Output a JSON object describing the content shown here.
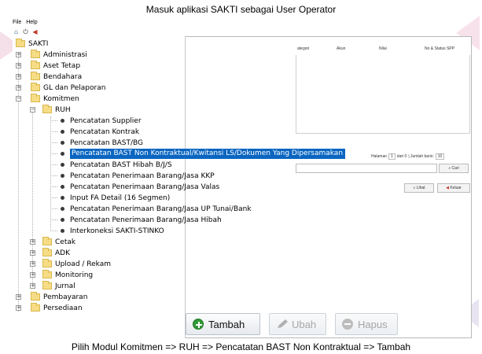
{
  "caption_top": "Masuk aplikasi SAKTI sebagai User Operator",
  "caption_bottom": "Pilih Modul Komitmen => RUH => Pencatatan BAST Non Kontraktual => Tambah",
  "menu": {
    "file": "File",
    "help": "Help"
  },
  "toolbar_icons": [
    "home-icon",
    "power-icon",
    "logout-icon"
  ],
  "tree": {
    "root": "SAKTI",
    "nodes": {
      "administrasi": "Administrasi",
      "aset_tetap": "Aset Tetap",
      "bendahara": "Bendahara",
      "gl": "GL dan Pelaporan",
      "komitmen": "Komitmen",
      "ruh": "RUH",
      "ruh_items": [
        "Pencatatan Supplier",
        "Pencatatan Kontrak",
        "Pencatatan BAST/BG",
        "Pencatatan BAST Non Kontraktual/Kwitansi LS/Dokumen Yang Dipersamakan",
        "Pencatatan BAST Hibah B/J/S",
        "Pencatatan Penerimaan Barang/Jasa KKP",
        "Pencatatan Penerimaan Barang/Jasa Valas",
        "Input FA Detail (16 Segmen)",
        "Pencatatan Penerimaan Barang/Jasa UP Tunai/Bank",
        "Pencatatan Penerimaan Barang/Jasa Hibah",
        "Interkoneksi SAKTI-STINKO"
      ],
      "cetak": "Cetak",
      "adk": "ADK",
      "upload": "Upload / Rekam",
      "monitoring": "Monitoring",
      "jurnal": "Jurnal",
      "pembayaran": "Pembayaran",
      "persediaan": "Persediaan"
    }
  },
  "grid": {
    "headers": [
      "ategori",
      "Akun",
      "Nilai",
      "No & Status SPP"
    ]
  },
  "pager": {
    "halaman_label": "Halaman",
    "page_value": "1",
    "of_label": "dari 0",
    "rows_label": "| Jumlah baris:",
    "rows_value": "10"
  },
  "search": {
    "button": "Cari"
  },
  "side_buttons": {
    "lihat": "Lihat",
    "keluar": "Keluar"
  },
  "actions": {
    "tambah": "Tambah",
    "ubah": "Ubah",
    "hapus": "Hapus"
  }
}
